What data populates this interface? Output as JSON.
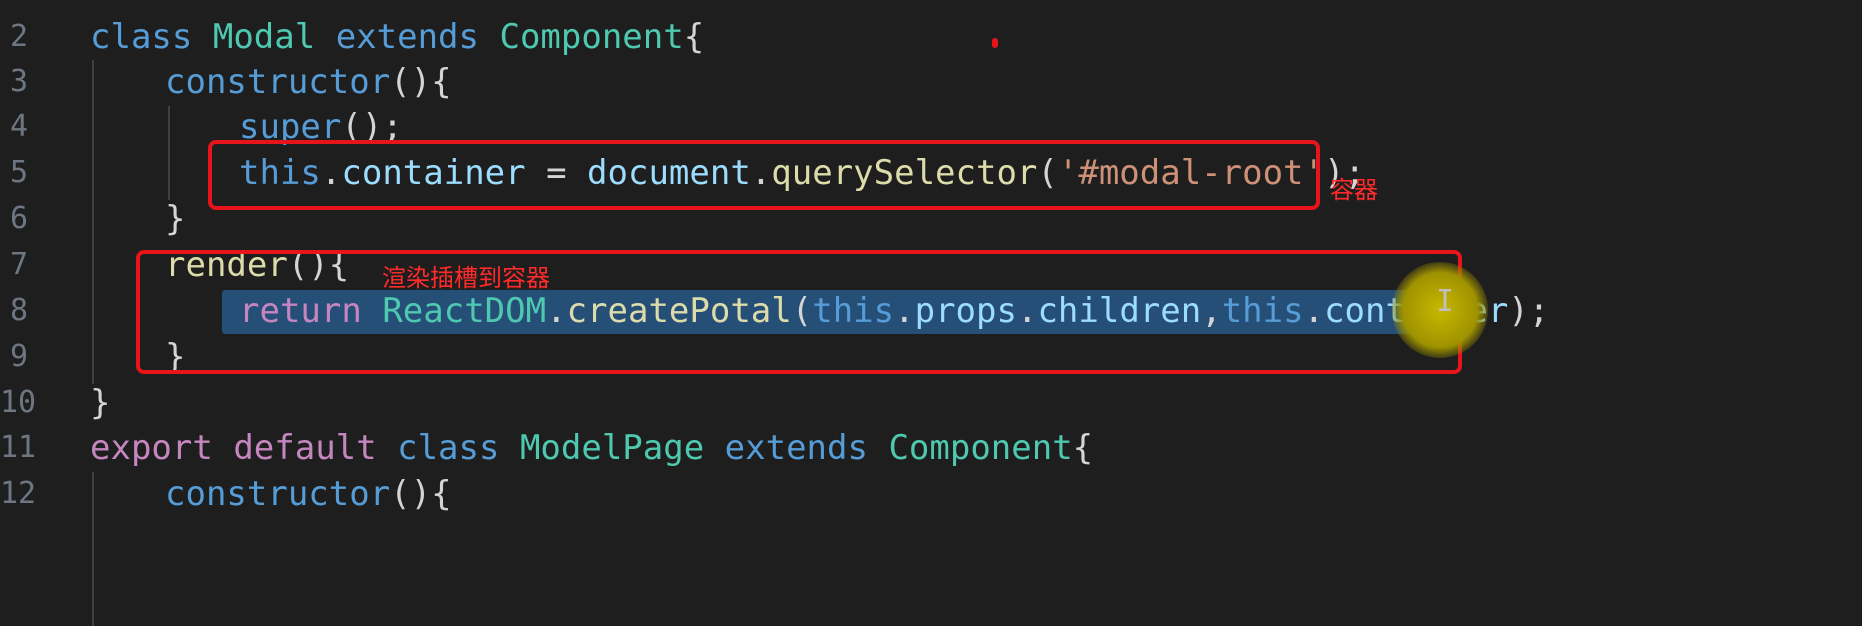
{
  "editor": {
    "line_numbers": [
      "2",
      "3",
      "4",
      "5",
      "6",
      "7",
      "8",
      "9",
      "10",
      "11",
      "12"
    ],
    "lines": {
      "l2": {
        "kw": "class",
        "cls": "Modal",
        "kw2": "extends",
        "cls2": "Component",
        "brace": "{"
      },
      "l3": {
        "fn": "constructor",
        "rest": "(){"
      },
      "l4": {
        "kw": "super",
        "rest": "();"
      },
      "l5": {
        "kw": "this",
        "p1": ".",
        "prop": "container",
        "eq": " = ",
        "obj": "document",
        "p2": ".",
        "fn": "querySelector",
        "open": "(",
        "str": "'#modal-root'",
        "close": ");"
      },
      "l6": {
        "rest": "}"
      },
      "l7": {
        "fn": "render",
        "rest": "(){"
      },
      "l8": {
        "kw": "return",
        "sp": " ",
        "obj": "ReactDOM",
        "p1": ".",
        "fn": "createPotal",
        "open": "(",
        "kw2": "this",
        "p2": ".",
        "prop1": "props",
        "p3": ".",
        "prop2": "children",
        "comma": ",",
        "kw3": "this",
        "p4": ".",
        "prop3": "container",
        "close": ");"
      },
      "l9": {
        "rest": "}"
      },
      "l10": {
        "rest": "}"
      },
      "l11": {
        "kw2": "export",
        "sp1": " ",
        "kw2b": "default",
        "sp2": " ",
        "kw": "class",
        "sp3": " ",
        "cls": "ModelPage",
        "sp4": " ",
        "kw3": "extends",
        "sp5": " ",
        "cls2": "Component",
        "brace": "{"
      },
      "l12": {
        "fn": "constructor",
        "rest": "(){"
      }
    }
  },
  "annotations": {
    "container_label": "容器",
    "render_label": "渲染插槽到容器"
  },
  "colors": {
    "annotation_red": "#e8141c",
    "keyword_blue": "#569cd6",
    "class_teal": "#4ec9b0",
    "function_yellow": "#dcdcaa",
    "string_orange": "#ce9178",
    "selection_blue": "#264f78"
  }
}
